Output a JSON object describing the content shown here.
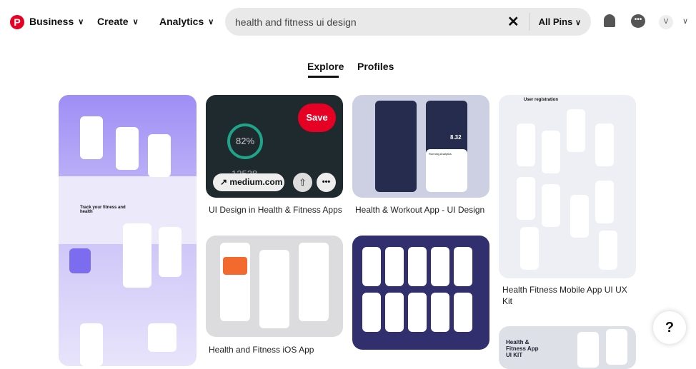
{
  "header": {
    "logo": "pinterest-logo",
    "nav": [
      {
        "label": "Business"
      },
      {
        "label": "Create"
      },
      {
        "label": "Analytics"
      }
    ],
    "search": {
      "value": "health and fitness ui design",
      "filter": "All Pins"
    },
    "avatar": "V"
  },
  "tabs": [
    {
      "label": "Explore",
      "active": true
    },
    {
      "label": "Profiles",
      "active": false
    }
  ],
  "pins": [
    {
      "title": "",
      "image_text": "Track your fitness and health"
    },
    {
      "title": "UI Design in Health & Fitness Apps",
      "save": "Save",
      "link": "medium.com",
      "image_text": [
        "82%",
        "12538"
      ]
    },
    {
      "title": "Health & Workout App - UI Design",
      "image_text": [
        "8.32",
        "Running Analytics"
      ]
    },
    {
      "title": "Health Fitness Mobile App UI UX Kit",
      "image_text": "User registration"
    },
    {
      "title": "Health and Fitness iOS App"
    },
    {
      "title": ""
    },
    {
      "title": "",
      "image_text": "Health & Fitness App UI KIT"
    }
  ],
  "help": "?",
  "colors": {
    "brand": "#e60023",
    "purple": "#8b7cf0"
  }
}
